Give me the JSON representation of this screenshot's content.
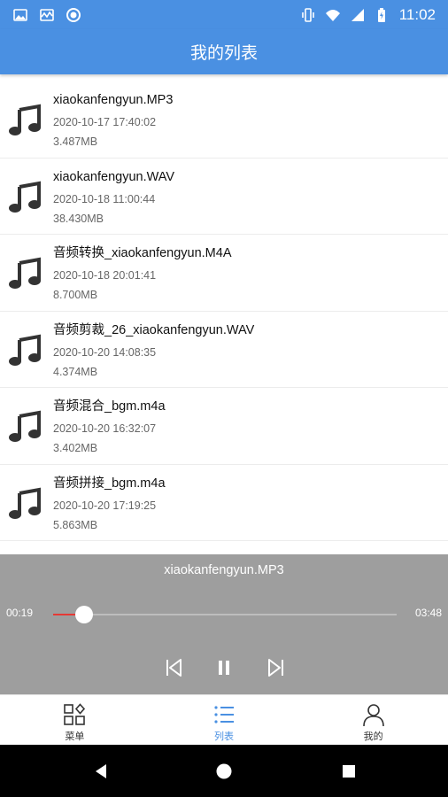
{
  "status_bar": {
    "time": "11:02",
    "left_icons": [
      "image-icon",
      "activity-icon",
      "circle-icon"
    ],
    "right_icons": [
      "vibrate-icon",
      "wifi-icon",
      "signal-icon",
      "battery-icon"
    ]
  },
  "app_bar": {
    "title": "我的列表"
  },
  "files": [
    {
      "name": "xiaokanfengyun.MP3",
      "date": "2020-10-17 17:40:02",
      "size": "3.487MB",
      "icon": "music-note-icon"
    },
    {
      "name": "xiaokanfengyun.WAV",
      "date": "2020-10-18 11:00:44",
      "size": "38.430MB",
      "icon": "music-note-icon"
    },
    {
      "name": "音频转换_xiaokanfengyun.M4A",
      "date": "2020-10-18 20:01:41",
      "size": "8.700MB",
      "icon": "music-note-icon"
    },
    {
      "name": "音频剪裁_26_xiaokanfengyun.WAV",
      "date": "2020-10-20 14:08:35",
      "size": "4.374MB",
      "icon": "music-note-icon"
    },
    {
      "name": "音频混合_bgm.m4a",
      "date": "2020-10-20 16:32:07",
      "size": "3.402MB",
      "icon": "music-note-icon"
    },
    {
      "name": "音频拼接_bgm.m4a",
      "date": "2020-10-20 17:19:25",
      "size": "5.863MB",
      "icon": "music-note-icon"
    }
  ],
  "player": {
    "title": "xiaokanfengyun.MP3",
    "current_time": "00:19",
    "total_time": "03:48",
    "progress": 0.09,
    "played_color": "#e53935",
    "controls": [
      "skip-previous-icon",
      "pause-icon",
      "skip-next-icon"
    ]
  },
  "bottom_nav": {
    "items": [
      {
        "label": "菜单",
        "icon": "grid-menu-icon",
        "active": false
      },
      {
        "label": "列表",
        "icon": "list-icon",
        "active": true
      },
      {
        "label": "我的",
        "icon": "person-icon",
        "active": false
      }
    ]
  },
  "colors": {
    "primary": "#4a90e2",
    "player_bg": "#9e9e9e",
    "active_nav": "#4a90e2"
  }
}
